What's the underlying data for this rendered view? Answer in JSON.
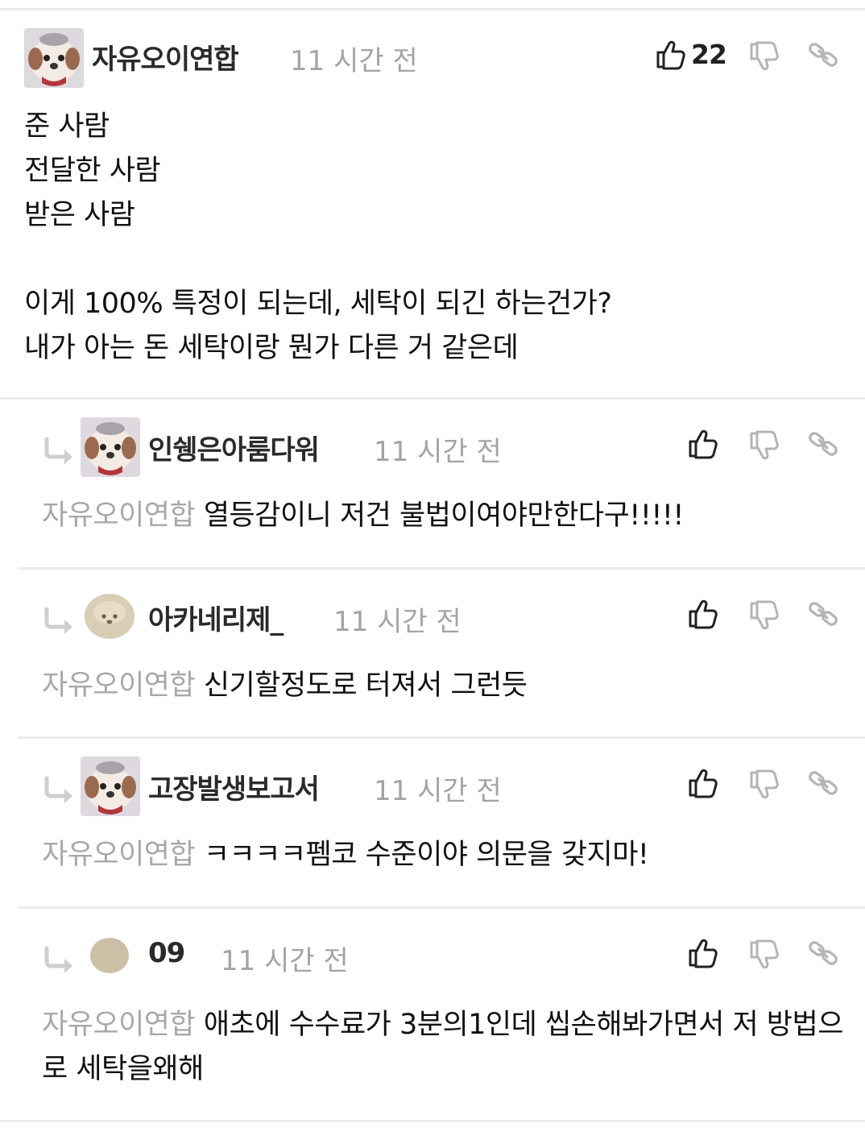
{
  "main_comment": {
    "author": "자유오이연합",
    "time": "11 시간 전",
    "like_count": "22",
    "body": "준 사람\n전달한 사람\n받은 사람\n\n이게 100% 특정이 되는데, 세탁이 되긴 하는건가?\n내가 아는 돈 세탁이랑 뭔가 다른 거 같은데"
  },
  "replies": [
    {
      "author": "인쉥은아룸다워",
      "time": "11 시간 전",
      "mention": "자유오이연합",
      "text": "열등감이니 저건 불법이여야만한다구!!!!!",
      "avatar": "dog"
    },
    {
      "author": "아카네리제_",
      "time": "11 시간 전",
      "mention": "자유오이연합",
      "text": "신기할정도로 터져서 그런듯",
      "avatar": "puppy"
    },
    {
      "author": "고장발생보고서",
      "time": "11 시간 전",
      "mention": "자유오이연합",
      "text": "ㅋㅋㅋㅋ펨코 수준이야 의문을 갖지마!",
      "avatar": "dog"
    },
    {
      "author": "09",
      "time": "11 시간 전",
      "mention": "자유오이연합",
      "text": "애초에 수수료가 3분의1인데 씹손해봐가면서 저 방법으로 세탁을왜해",
      "avatar": "plain"
    }
  ],
  "icons": {
    "like": "thumbs-up-icon",
    "dislike": "thumbs-down-icon",
    "link": "link-icon",
    "reply": "reply-arrow-icon"
  },
  "colors": {
    "text": "#111111",
    "muted": "#a4a4a4",
    "divider": "#ececec",
    "icon": "#222222",
    "icon_muted": "#b5b5b5"
  }
}
